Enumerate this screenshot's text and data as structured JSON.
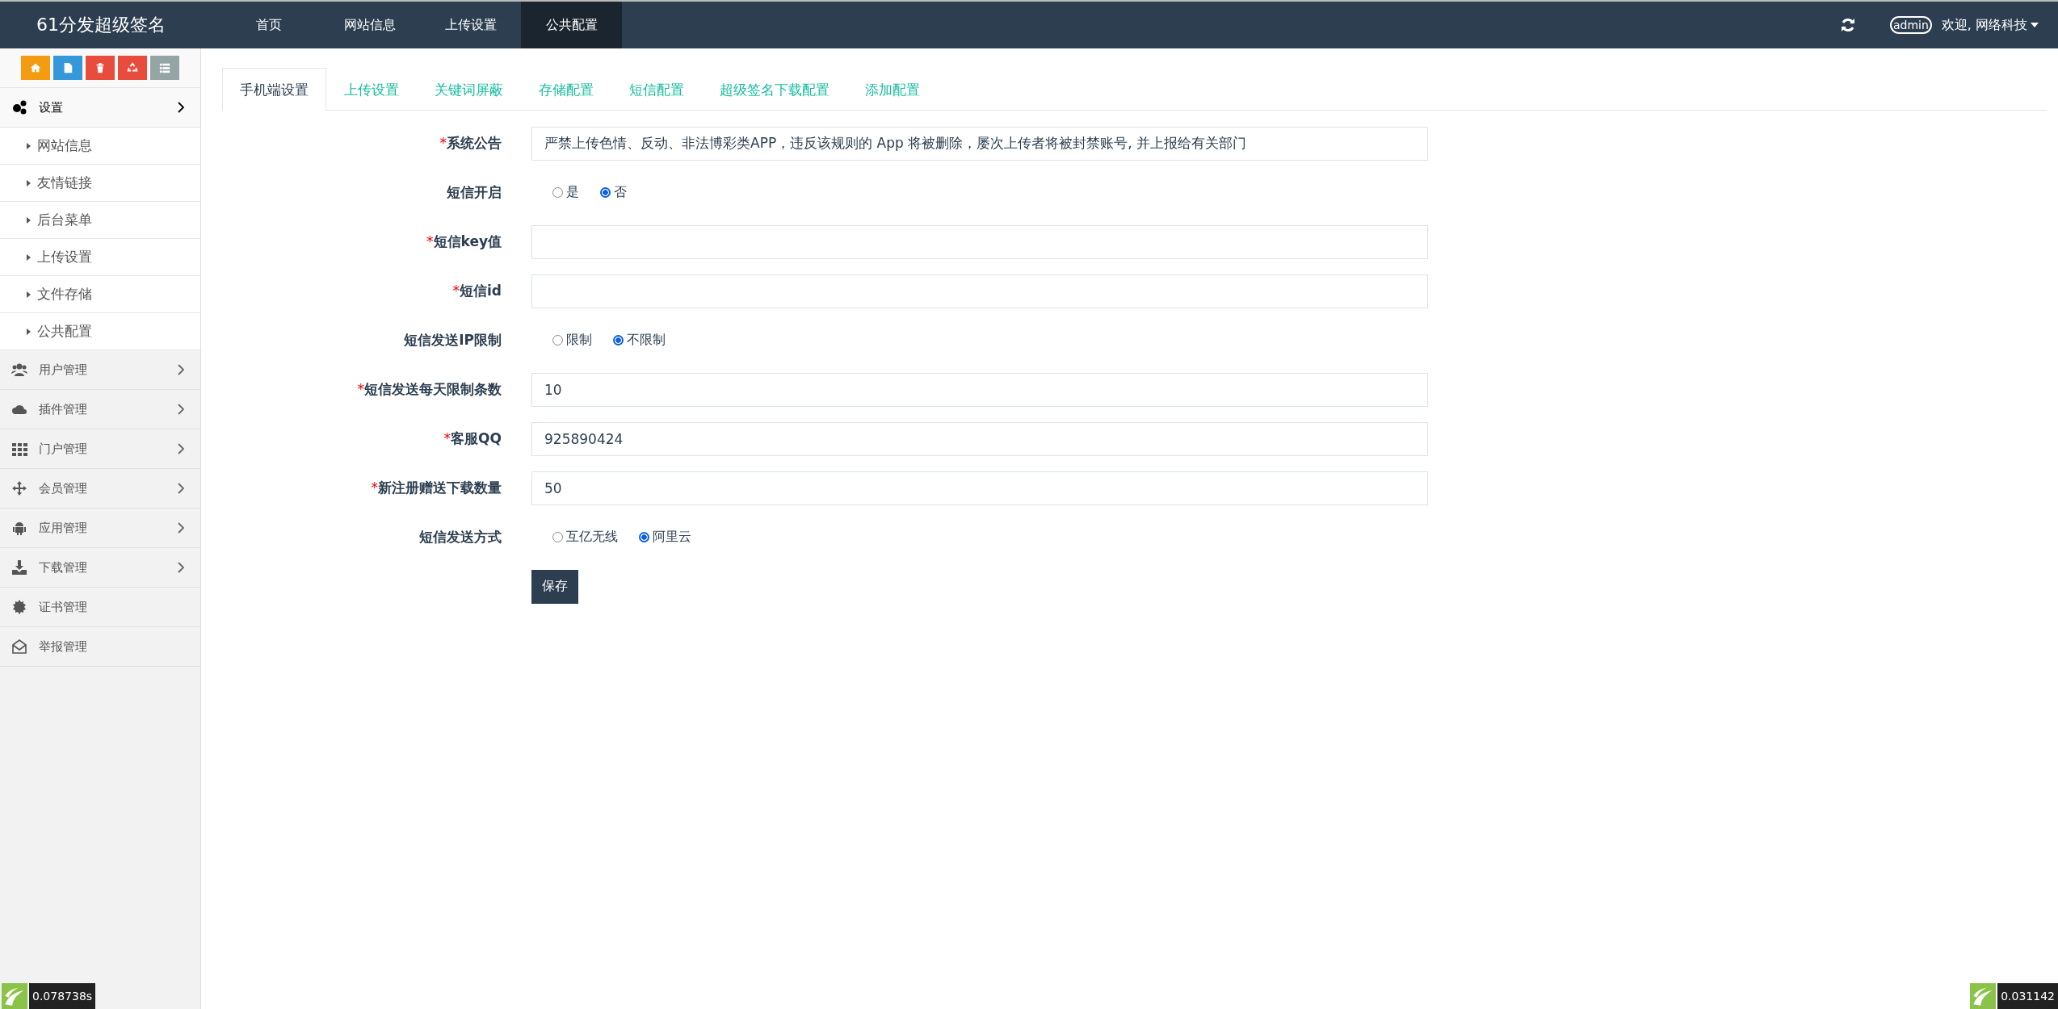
{
  "header": {
    "brand": "61分发超级签名",
    "nav": [
      {
        "label": "首页",
        "selected": false
      },
      {
        "label": "网站信息",
        "selected": false
      },
      {
        "label": "上传设置",
        "selected": false
      },
      {
        "label": "公共配置",
        "selected": true
      }
    ],
    "user_badge": "admin",
    "welcome": "欢迎, 网络科技"
  },
  "sidebar": {
    "toolbar": [
      {
        "color": "#f39c12"
      },
      {
        "color": "#3498db"
      },
      {
        "color": "#e74c3c"
      },
      {
        "color": "#e74c3c"
      },
      {
        "color": "#95a5a6"
      }
    ],
    "items": [
      {
        "label": "设置",
        "expanded": true,
        "submenu": true,
        "children": [
          {
            "label": "网站信息"
          },
          {
            "label": "友情链接"
          },
          {
            "label": "后台菜单"
          },
          {
            "label": "上传设置"
          },
          {
            "label": "文件存储"
          },
          {
            "label": "公共配置"
          }
        ]
      },
      {
        "label": "用户管理",
        "expanded": false,
        "submenu": true
      },
      {
        "label": "插件管理",
        "expanded": false,
        "submenu": true
      },
      {
        "label": "门户管理",
        "expanded": false,
        "submenu": true
      },
      {
        "label": "会员管理",
        "expanded": false,
        "submenu": true
      },
      {
        "label": "应用管理",
        "expanded": false,
        "submenu": true
      },
      {
        "label": "下载管理",
        "expanded": false,
        "submenu": true
      },
      {
        "label": "证书管理",
        "expanded": false,
        "submenu": false
      },
      {
        "label": "举报管理",
        "expanded": false,
        "submenu": false
      }
    ]
  },
  "tabs": [
    {
      "label": "手机端设置",
      "selected": true
    },
    {
      "label": "上传设置",
      "selected": false
    },
    {
      "label": "关键词屏蔽",
      "selected": false
    },
    {
      "label": "存储配置",
      "selected": false
    },
    {
      "label": "短信配置",
      "selected": false
    },
    {
      "label": "超级签名下载配置",
      "selected": false
    },
    {
      "label": "添加配置",
      "selected": false
    }
  ],
  "form": {
    "fields": [
      {
        "kind": "text",
        "label": "系统公告",
        "required_mark": "*",
        "value": "严禁上传色情、反动、非法博彩类APP，违反该规则的 App 将被删除，屡次上传者将被封禁账号, 并上报给有关部门"
      },
      {
        "kind": "radio",
        "label": "短信开启",
        "options": [
          {
            "label": "是",
            "selected": false
          },
          {
            "label": "否",
            "selected": true
          }
        ]
      },
      {
        "kind": "text",
        "label": "短信key值",
        "required_mark": "*"
      },
      {
        "kind": "text",
        "label": "短信id",
        "required_mark": "*"
      },
      {
        "kind": "radio",
        "label": "短信发送IP限制",
        "options": [
          {
            "label": "限制",
            "selected": false
          },
          {
            "label": "不限制",
            "selected": true
          }
        ]
      },
      {
        "kind": "text",
        "label": "短信发送每天限制条数",
        "required_mark": "*",
        "value": "10"
      },
      {
        "kind": "text",
        "label": "客服QQ",
        "required_mark": "*",
        "value": "925890424"
      },
      {
        "kind": "text",
        "label": "新注册赠送下载数量",
        "required_mark": "*",
        "value": "50"
      },
      {
        "kind": "radio",
        "label": "短信发送方式",
        "options": [
          {
            "label": "互亿无线",
            "selected": false
          },
          {
            "label": "阿里云",
            "selected": true
          }
        ]
      }
    ],
    "save_button": "保存"
  },
  "debug": {
    "left_time": "0.078738s",
    "right_time": "0.031142"
  }
}
